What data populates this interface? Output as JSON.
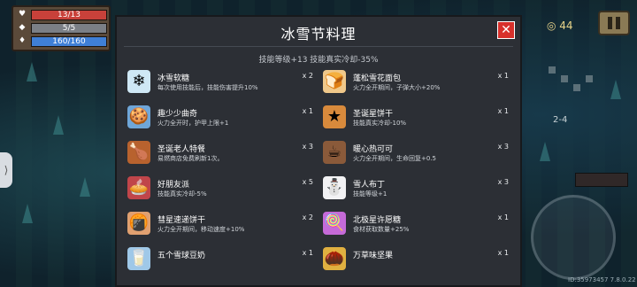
{
  "hud": {
    "hp": "13/13",
    "armor": "5/5",
    "energy": "160/160",
    "coins": "44",
    "level": "2-4"
  },
  "version": "ID:35973457 7.8.0.22",
  "colors": {
    "panel": "#2c2f35",
    "close": "#d8302b",
    "hp": "#c8413a",
    "energy": "#3f7fd6"
  },
  "panel": {
    "title": "冰雪节料理",
    "subtitle": "技能等级+13 技能真实冷却-35%",
    "close_icon": "close-icon",
    "items": [
      {
        "name": "冰雪软糖",
        "desc": "每次使用技能后，技能伤害提升10%",
        "qty": "x 2",
        "icon": "ice-cube-icon",
        "color": "#cfe8f5",
        "glyph": "❄"
      },
      {
        "name": "蓬松雪花面包",
        "desc": "火力全开期间，子弹大小+20%",
        "qty": "x 1",
        "icon": "bread-icon",
        "color": "#f0c88a",
        "glyph": "🍞"
      },
      {
        "name": "趣少少曲奇",
        "desc": "火力全开时，护甲上限+1",
        "qty": "x 1",
        "icon": "cookie-box-icon",
        "color": "#6fa6d8",
        "glyph": "🍪"
      },
      {
        "name": "圣诞星饼干",
        "desc": "技能真实冷却-10%",
        "qty": "x 1",
        "icon": "star-cookie-icon",
        "color": "#d88a3c",
        "glyph": "★"
      },
      {
        "name": "圣诞老人特餐",
        "desc": "易燃商店免费刷新1次。",
        "qty": "x 3",
        "icon": "roast-chicken-icon",
        "color": "#b8622e",
        "glyph": "🍗"
      },
      {
        "name": "暖心热可可",
        "desc": "火力全开期间，生命回复+0.5",
        "qty": "x 3",
        "icon": "cocoa-mug-icon",
        "color": "#8a5a3a",
        "glyph": "☕"
      },
      {
        "name": "好朋友派",
        "desc": "技能真实冷却-5%",
        "qty": "x 5",
        "icon": "pie-icon",
        "color": "#c0454a",
        "glyph": "🥧"
      },
      {
        "name": "雪人布丁",
        "desc": "技能等级+1",
        "qty": "x 3",
        "icon": "snowman-pudding-icon",
        "color": "#f2f2f4",
        "glyph": "⛄"
      },
      {
        "name": "彗星速递饼干",
        "desc": "火力全开期间，移动速度+10%",
        "qty": "x 2",
        "icon": "comet-cookie-icon",
        "color": "#e0a070",
        "glyph": "🍘"
      },
      {
        "name": "北极星许愿糖",
        "desc": "食材获取数量+25%",
        "qty": "x 1",
        "icon": "lollipop-icon",
        "color": "#c56ad8",
        "glyph": "🍭"
      },
      {
        "name": "五个雪球豆奶",
        "desc": "",
        "qty": "x 1",
        "icon": "milk-carton-icon",
        "color": "#9fc8e8",
        "glyph": "🥛"
      },
      {
        "name": "万草味坚果",
        "desc": "",
        "qty": "x 1",
        "icon": "nut-icon",
        "color": "#e0b040",
        "glyph": "🌰"
      }
    ]
  }
}
